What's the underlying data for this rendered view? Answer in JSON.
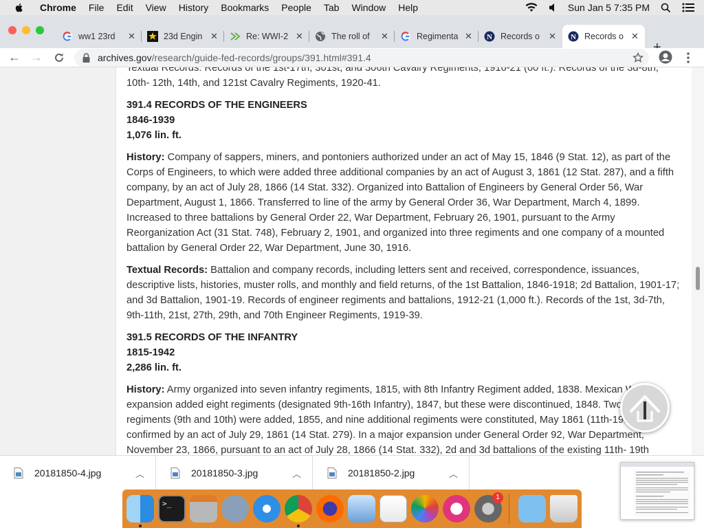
{
  "menubar": {
    "app": "Chrome",
    "items": [
      "File",
      "Edit",
      "View",
      "History",
      "Bookmarks",
      "People",
      "Tab",
      "Window",
      "Help"
    ],
    "clock": "Sun Jan 5  7:35 PM"
  },
  "tabs": [
    {
      "label": "ww1 23rd",
      "icon": "google-icon"
    },
    {
      "label": "23d Engin",
      "icon": "star-icon"
    },
    {
      "label": "Re: WWI-2",
      "icon": "forward-icon"
    },
    {
      "label": "The roll of",
      "icon": "globe-icon"
    },
    {
      "label": "Regimenta",
      "icon": "google-icon"
    },
    {
      "label": "Records o",
      "icon": "n-icon"
    },
    {
      "label": "Records o",
      "icon": "n-icon",
      "active": true
    }
  ],
  "toolbar": {
    "url_domain": "archives.gov",
    "url_path": "/research/guide-fed-records/groups/391.html#391.4"
  },
  "content": {
    "cavalry_tail": "Textual Records: Records of the 1st-17th, 301st, and 306th Cavalry Regiments, 1916-21 (60 ft.). Records of the 3d-8th, 10th- 12th, 14th, and 121st Cavalry Regiments, 1920-41.",
    "engineers": {
      "heading": "391.4 RECORDS OF THE ENGINEERS",
      "years": "1846-1939",
      "extent": "1,076 lin. ft.",
      "history_label": "History:",
      "history": " Company of sappers, miners, and pontoniers authorized under an act of May 15, 1846 (9 Stat. 12), as part of the Corps of Engineers, to which were added three additional companies by an act of August 3, 1861 (12 Stat. 287), and a fifth company, by an act of July 28, 1866 (14 Stat. 332). Organized into Battalion of Engineers by General Order 56, War Department, August 1, 1866. Transferred to line of the army by General Order 36, War Department, March 4, 1899. Increased to three battalions by General Order 22, War Department, February 26, 1901, pursuant to the Army Reorganization Act (31 Stat. 748), February 2, 1901, and organized into three regiments and one company of a mounted battalion by General Order 22, War Department, June 30, 1916.",
      "textual_label": "Textual Records:",
      "textual": " Battalion and company records, including letters sent and received, correspondence, issuances, descriptive lists, histories, muster rolls, and monthly and field returns, of the 1st Battalion, 1846-1918; 2d Battalion, 1901-17; and 3d Battalion, 1901-19. Records of engineer regiments and battalions, 1912-21 (1,000 ft.). Records of the 1st, 3d-7th, 9th-11th, 21st, 27th, 29th, and 70th Engineer Regiments, 1919-39."
    },
    "infantry": {
      "heading": "391.5 RECORDS OF THE INFANTRY",
      "years": "1815-1942",
      "extent": "2,286 lin. ft.",
      "history_label": "History:",
      "history": " Army organized into seven infantry regiments, 1815, with 8th Infantry Regiment added, 1838. Mexican War expansion added eight regiments (designated 9th-16th Infantry), 1847, but these were discontinued, 1848. Two new regiments (9th and 10th) were added, 1855, and nine additional regiments were constituted, May 1861 (11th-19th) and confirmed by an act of July 29, 1861 (14 Stat. 279). In a major expansion under General Order 92, War Department, November 23, 1866, pursuant to an act of July 28, 1866 (14 Stat. 332), 2d and 3d battalions of the existing 11th- 19th"
    }
  },
  "downloads": [
    "20181850-4.jpg",
    "20181850-3.jpg",
    "20181850-2.jpg"
  ],
  "dock_apps": [
    "finder-icon",
    "terminal-icon",
    "calculator-icon",
    "launchpad-icon",
    "safari-icon",
    "chrome-icon",
    "firefox-icon",
    "preview-icon",
    "textedit-icon",
    "photos-icon",
    "itunes-icon",
    "system-preferences-icon",
    "downloads-folder-icon",
    "trash-icon"
  ],
  "dock_badge": "1"
}
